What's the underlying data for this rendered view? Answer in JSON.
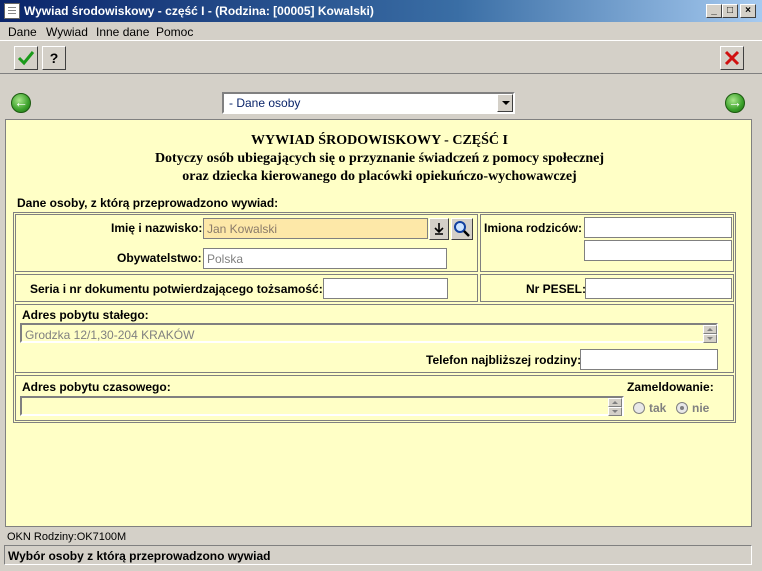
{
  "window": {
    "title": "Wywiad środowiskowy - część I - (Rodzina: [00005] Kowalski)",
    "controls": [
      "_",
      "□",
      "×"
    ]
  },
  "menu": [
    "Dane",
    "Wywiad",
    "Inne dane",
    "Pomoc"
  ],
  "toolbar": {
    "accept_icon": "check-icon",
    "help_label": "?",
    "close_icon": "red-x-icon"
  },
  "nav": {
    "prev_icon": "arrow-left-icon",
    "next_icon": "arrow-right-icon",
    "section_value": "- Dane osoby"
  },
  "form": {
    "heading_line1": "WYWIAD ŚRODOWISKOWY - CZĘŚĆ I",
    "heading_line2": "Dotyczy osób ubiegających się o przyznanie świadczeń z pomocy społecznej",
    "heading_line3": "oraz dziecka kierowanego do placówki opiekuńczo-wychowawczej",
    "section_label": "Dane osoby, z którą przeprowadzono wywiad:",
    "name_label": "Imię i nazwisko:",
    "name_value": "Jan Kowalski",
    "parents_label": "Imiona rodziców:",
    "parents_value1": "",
    "parents_value2": "",
    "citizenship_label": "Obywatelstwo:",
    "citizenship_value": "Polska",
    "id_doc_label": "Seria i nr dokumentu potwierdzającego tożsamość:",
    "id_doc_value": "",
    "pesel_label": "Nr PESEL:",
    "pesel_value": "",
    "perm_address_label": "Adres pobytu stałego:",
    "perm_address_value": "Grodzka 12/1,30-204 KRAKÓW",
    "phone_label": "Telefon najbliższej rodziny:",
    "phone_value": "",
    "temp_address_label": "Adres pobytu czasowego:",
    "temp_address_value": "",
    "registration_label": "Zameldowanie:",
    "registration_options": [
      "tak",
      "nie"
    ],
    "registration_selected": "nie"
  },
  "status": {
    "okn": "OKN Rodziny:OK7100M",
    "message": "Wybór osoby z którą przeprowadzono wywiad"
  },
  "colors": {
    "panel_bg": "#ffffc6",
    "title_bar": "#0a246a",
    "field_highlight": "#fde8a8"
  }
}
